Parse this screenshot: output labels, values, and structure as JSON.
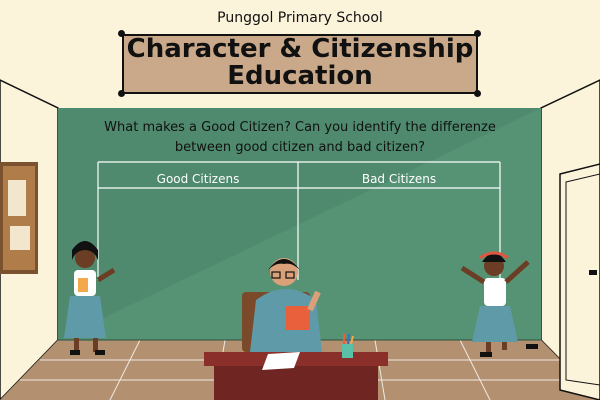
{
  "header": {
    "school": "Punggol Primary School",
    "title": "Character & Citizenship Education"
  },
  "board": {
    "question": "What makes a Good Citizen? Can you identify the differenze between good citizen and bad citizen?",
    "columns": [
      "Good Citizens",
      "Bad Citizens"
    ]
  },
  "colors": {
    "background": "#fbf3da",
    "board": "#4f8a6e",
    "title_box": "#c9a98a",
    "floor": "#b39070"
  }
}
